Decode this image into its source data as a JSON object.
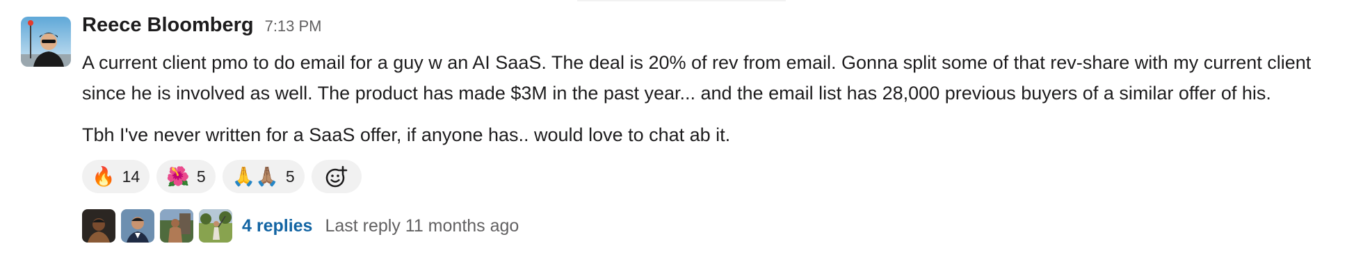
{
  "message": {
    "author": "Reece Bloomberg",
    "timestamp": "7:13 PM",
    "paragraphs": [
      "A current client pmo to do email for a guy w an AI SaaS. The deal is 20% of rev from email. Gonna split some of that rev-share with my current client since he is involved as well. The product has made $3M in the past year... and the email list has 28,000 previous buyers of a similar offer of his.",
      "Tbh I've never written for a SaaS offer, if anyone has.. would love to chat ab it."
    ]
  },
  "reactions": [
    {
      "emoji": "🔥",
      "icon": "fire-icon",
      "count": "14"
    },
    {
      "emoji": "🌺",
      "icon": "hibiscus-icon",
      "count": "5"
    },
    {
      "emoji": "🙏🙏🏽",
      "icon": "folded-hands-icon",
      "count": "5"
    }
  ],
  "add_reaction_icon": "add-emoji-icon",
  "thread": {
    "replies_label": "4 replies",
    "last_reply": "Last reply 11 months ago"
  },
  "colors": {
    "link": "#1264a3",
    "muted": "#616061",
    "reaction_bg": "#f1f1f1"
  }
}
